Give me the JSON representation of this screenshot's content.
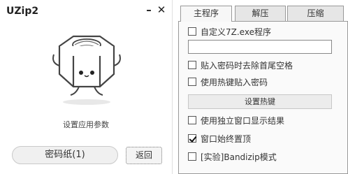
{
  "app": {
    "title": "UZip2",
    "minimize_glyph": "–",
    "close_glyph": "✕"
  },
  "left": {
    "mascot_icon": "nut-mascot-icon",
    "caption": "设置应用参数",
    "pw_button_label": "密码纸(1)",
    "back_button_label": "返回"
  },
  "tabs": [
    {
      "label": "主程序",
      "active": true
    },
    {
      "label": "解压",
      "active": false
    },
    {
      "label": "压缩",
      "active": false
    }
  ],
  "options": {
    "custom_exe": {
      "label": "自定义7Z.exe程序",
      "checked": false
    },
    "exe_path": {
      "value": "",
      "placeholder": ""
    },
    "trim_spaces": {
      "label": "贴入密码时去除首尾空格",
      "checked": false
    },
    "hotkey_paste": {
      "label": "使用热键贴入密码",
      "checked": false
    },
    "set_hotkey_label": "设置热键",
    "separate_window": {
      "label": "使用独立窗口显示结果",
      "checked": false
    },
    "always_on_top": {
      "label": "窗口始终置顶",
      "checked": true
    },
    "bandizip_mode": {
      "label": "[实验]Bandizip模式",
      "checked": false
    }
  },
  "colors": {
    "border": "#999999",
    "tab_bg": "#e6e6e6",
    "panel_bg": "#fafafa"
  }
}
